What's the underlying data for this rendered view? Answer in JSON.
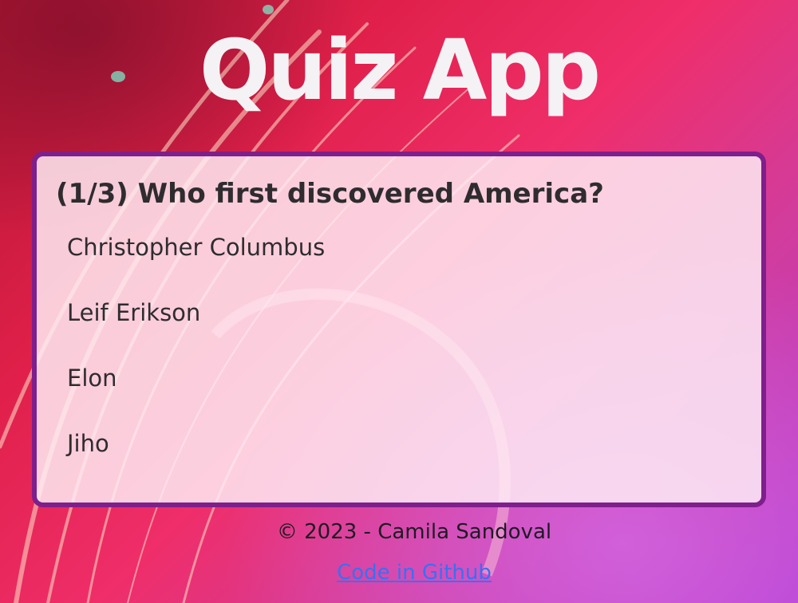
{
  "app": {
    "title": "Quiz App"
  },
  "quiz": {
    "question": "(1/3) Who first discovered America?",
    "answers": [
      "Christopher Columbus",
      "Leif Erikson",
      "Elon",
      "Jiho"
    ]
  },
  "footer": {
    "copyright": "© 2023 - Camila Sandoval",
    "link_text": "Code in Github"
  },
  "colors": {
    "card_border": "#7e1f8c",
    "link": "#3a6ff2"
  }
}
